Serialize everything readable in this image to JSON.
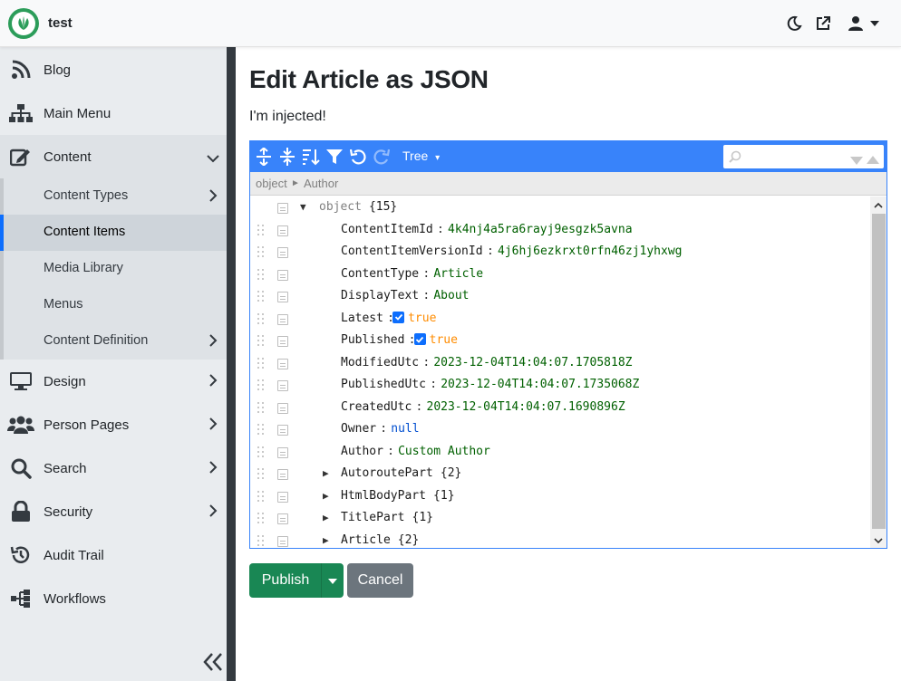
{
  "app": {
    "brand": "test"
  },
  "header": {
    "icons": [
      "moon-icon",
      "external-link-icon",
      "user-icon",
      "caret-down-icon"
    ]
  },
  "sidebar": {
    "items": [
      {
        "label": "Blog",
        "icon": "rss-icon"
      },
      {
        "label": "Main Menu",
        "icon": "sitemap-icon"
      },
      {
        "label": "Content",
        "icon": "edit-icon",
        "expanded": true
      },
      {
        "label": "Design",
        "icon": "monitor-icon"
      },
      {
        "label": "Person Pages",
        "icon": "users-icon"
      },
      {
        "label": "Search",
        "icon": "search-icon"
      },
      {
        "label": "Security",
        "icon": "lock-icon"
      },
      {
        "label": "Audit Trail",
        "icon": "history-icon"
      },
      {
        "label": "Workflows",
        "icon": "workflow-icon"
      }
    ],
    "content_sub": [
      {
        "label": "Content Types"
      },
      {
        "label": "Content Items",
        "active": true
      },
      {
        "label": "Media Library"
      },
      {
        "label": "Menus"
      },
      {
        "label": "Content Definition"
      }
    ]
  },
  "main": {
    "title": "Edit Article as JSON",
    "injected_text": "I'm injected!"
  },
  "editor": {
    "mode": "Tree",
    "mode_caret": "▾",
    "search_placeholder": "",
    "breadcrumb": [
      "object",
      "Author"
    ],
    "breadcrumb_sep": "►",
    "root": {
      "name": "object",
      "count": "{15}"
    },
    "fields": [
      {
        "key": "ContentItemId",
        "value": "4k4nj4a5ra6rayj9esgzk5avna",
        "type": "string"
      },
      {
        "key": "ContentItemVersionId",
        "value": "4j6hj6ezkrxt0rfn46zj1yhxwg",
        "type": "string"
      },
      {
        "key": "ContentType",
        "value": "Article",
        "type": "string"
      },
      {
        "key": "DisplayText",
        "value": "About",
        "type": "string"
      },
      {
        "key": "Latest",
        "value": "true",
        "type": "boolean"
      },
      {
        "key": "Published",
        "value": "true",
        "type": "boolean"
      },
      {
        "key": "ModifiedUtc",
        "value": "2023-12-04T14:04:07.1705818Z",
        "type": "string"
      },
      {
        "key": "PublishedUtc",
        "value": "2023-12-04T14:04:07.1735068Z",
        "type": "string"
      },
      {
        "key": "CreatedUtc",
        "value": "2023-12-04T14:04:07.1690896Z",
        "type": "string"
      },
      {
        "key": "Owner",
        "value": "null",
        "type": "null"
      },
      {
        "key": "Author",
        "value": "Custom Author",
        "type": "string"
      }
    ],
    "objects": [
      {
        "key": "AutoroutePart",
        "count": "{2}"
      },
      {
        "key": "HtmlBodyPart",
        "count": "{1}"
      },
      {
        "key": "TitlePart",
        "count": "{1}"
      },
      {
        "key": "Article",
        "count": "{2}"
      }
    ]
  },
  "actions": {
    "publish": "Publish",
    "cancel": "Cancel"
  },
  "colors": {
    "editor_accent": "#3883fa",
    "publish": "#198754",
    "cancel": "#6c757d",
    "string_value": "#006000",
    "boolean_value": "#ff8c00",
    "null_value": "#004ed0"
  }
}
